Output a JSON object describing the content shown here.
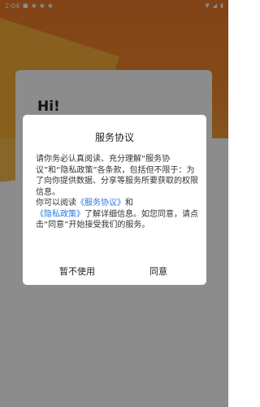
{
  "status_bar": {
    "time": "2:04",
    "left_icons": [
      "notification-icon",
      "app-icon",
      "app-icon",
      "app-icon"
    ],
    "right_icons": [
      "wifi-icon",
      "signal-icon",
      "battery-icon"
    ]
  },
  "background": {
    "greeting": "Hi!"
  },
  "dialog": {
    "title": "服务协议",
    "paragraph1": "请你务必认真阅读、充分理解“服务协议”和“隐私政策”各条款，包括但不限于：为了向你提供数据、分享等服务所要获取的权限信息。",
    "p2_prefix": "你可以阅读",
    "link_service": "《服务协议》",
    "p2_and": "和",
    "link_privacy": "《隐私政策》",
    "p2_suffix": "了解详细信息。如您同意，请点击“同意”开始接受我们的服务。",
    "decline_label": "暂不使用",
    "agree_label": "同意"
  },
  "colors": {
    "link": "#2a78e6",
    "brand_orange": "#ec7b2a"
  }
}
